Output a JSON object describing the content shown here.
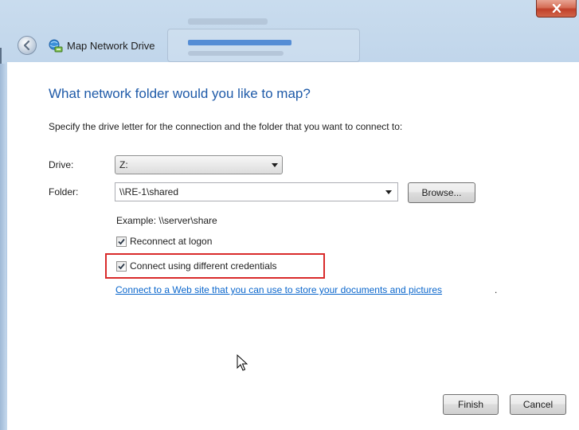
{
  "window": {
    "title": "Map Network Drive",
    "close_label": "X"
  },
  "page": {
    "heading": "What network folder would you like to map?",
    "instruction": "Specify the drive letter for the connection and the folder that you want to connect to:"
  },
  "form": {
    "drive_label": "Drive:",
    "drive_value": "Z:",
    "folder_label": "Folder:",
    "folder_value": "\\\\RE-1\\shared",
    "browse_label": "Browse...",
    "example_text": "Example: \\\\server\\share",
    "reconnect_label": "Reconnect at logon",
    "reconnect_checked": true,
    "credentials_label": "Connect using different credentials",
    "credentials_checked": true,
    "web_link_text": "Connect to a Web site that you can use to store your documents and pictures",
    "web_link_suffix": "."
  },
  "buttons": {
    "finish_label": "Finish",
    "cancel_label": "Cancel"
  },
  "colors": {
    "heading": "#1e5aa8",
    "link": "#0a66cc",
    "highlight_box": "#d92b2b",
    "close_button": "#c0402a"
  },
  "icons": {
    "back": "back-arrow-icon",
    "app": "network-drive-icon",
    "close": "close-icon",
    "dropdown": "chevron-down-icon",
    "checkbox": "checkmark-icon",
    "cursor": "mouse-pointer-icon"
  }
}
